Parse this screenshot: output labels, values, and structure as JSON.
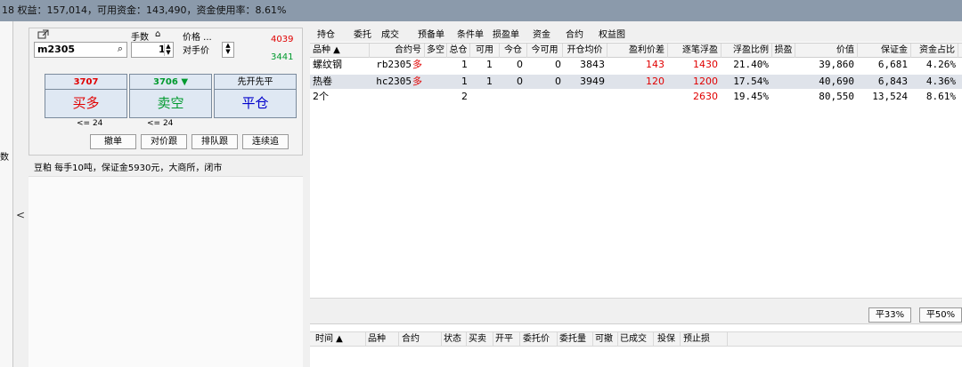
{
  "topbar": {
    "text": "18 权益：157,014，可用资金：143,490，资金使用率：8.61%"
  },
  "left_strip": {
    "text": "数",
    "arrow": "<"
  },
  "order_panel": {
    "contract": "m2305",
    "lots_label": "手数",
    "lots_value": "1",
    "price_label": "价格 ...",
    "price_value": "对手价",
    "up_count": "4039",
    "down_count": "3441",
    "buttons": {
      "buy": {
        "price": "3707",
        "label": "买多"
      },
      "sell": {
        "price": "3706",
        "label": "卖空"
      },
      "close": {
        "top": "先开先平",
        "label": "平仓"
      }
    },
    "limits": {
      "buy": "<= 24",
      "sell": "<= 24"
    },
    "small_buttons": [
      "撤单",
      "对价跟",
      "排队跟",
      "连续追"
    ]
  },
  "product_info": "豆粕 每手10吨，保证金5930元，大商所，闭市",
  "tabs": [
    "持仓",
    "委托",
    "成交",
    "预备单",
    "条件单",
    "损盈单",
    "资金",
    "合约",
    "权益图"
  ],
  "positions": {
    "headers": [
      "品种 ▲",
      "合约号",
      "多空",
      "总仓",
      "可用",
      "今仓",
      "今可用",
      "开仓均价",
      "盈利价差",
      "逐笔浮盈",
      "浮盈比例",
      "损盈",
      "价值",
      "保证金",
      "资金占比"
    ],
    "rows": [
      {
        "variety": "螺纹钢",
        "contract": "rb2305",
        "direction": "多",
        "total": "1",
        "avail": "1",
        "today": "0",
        "today_avail": "0",
        "open_avg": "3843",
        "profit_diff": "143",
        "float_profit": "1430",
        "ratio": "21.40%",
        "value": "39,860",
        "margin": "6,681",
        "fund_ratio": "4.26%"
      },
      {
        "variety": "热卷",
        "contract": "hc2305",
        "direction": "多",
        "total": "1",
        "avail": "1",
        "today": "0",
        "today_avail": "0",
        "open_avg": "3949",
        "profit_diff": "120",
        "float_profit": "1200",
        "ratio": "17.54%",
        "value": "40,690",
        "margin": "6,843",
        "fund_ratio": "4.36%"
      }
    ],
    "summary": {
      "variety": "2个",
      "total": "2",
      "float_profit": "2630",
      "ratio": "19.45%",
      "value": "80,550",
      "margin": "13,524",
      "fund_ratio": "8.61%"
    }
  },
  "close_buttons": [
    "平33%",
    "平50%"
  ],
  "orders": {
    "headers": [
      "时间 ▲",
      "品种",
      "合约",
      "状态",
      "买卖",
      "开平",
      "委托价",
      "委托量",
      "可撤",
      "已成交",
      "投保",
      "预止损"
    ]
  }
}
